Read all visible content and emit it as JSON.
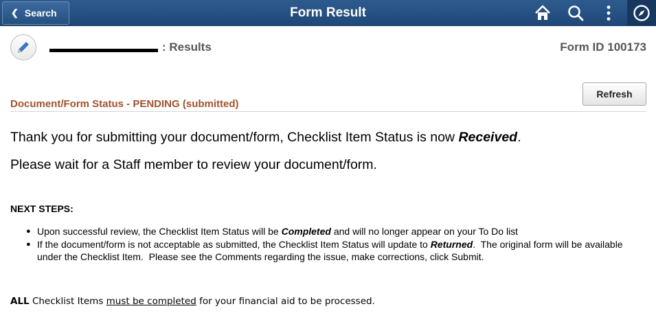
{
  "header": {
    "back_label": "Search",
    "title": "Form Result",
    "icons": [
      "home-icon",
      "search-icon",
      "more-vertical-icon",
      "navbar-compass-icon"
    ],
    "accent": "#1f4778"
  },
  "subheader": {
    "title_suffix": ": Results",
    "form_id_label": "Form ID",
    "form_id_value": "100173"
  },
  "status": {
    "heading": "Document/Form Status - PENDING (submitted)",
    "heading_color": "#a0522d",
    "refresh_label": "Refresh"
  },
  "messages": {
    "line1_prefix": "Thank you for submitting your document/form, Checklist Item Status is now ",
    "line1_emphasis": "Received",
    "line1_suffix": ".",
    "line2": "Please wait for a Staff member to review your document/form."
  },
  "next_steps": {
    "title": "NEXT STEPS:",
    "items": [
      {
        "prefix": "Upon successful review, the Checklist Item Status will be ",
        "emphasis": "Completed",
        "suffix": " and will no longer appear on your To Do list"
      },
      {
        "prefix": "If the document/form is not acceptable as submitted, the Checklist Item Status will update to ",
        "emphasis": "Returned",
        "suffix": ".  The original form will be available under the Checklist Item.  Please see the Comments regarding the issue, make corrections, click Submit."
      }
    ]
  },
  "footer": {
    "bold": "ALL",
    "pre": " Checklist Items ",
    "underlined": "must be completed",
    "post": " for your financial aid to be processed."
  }
}
